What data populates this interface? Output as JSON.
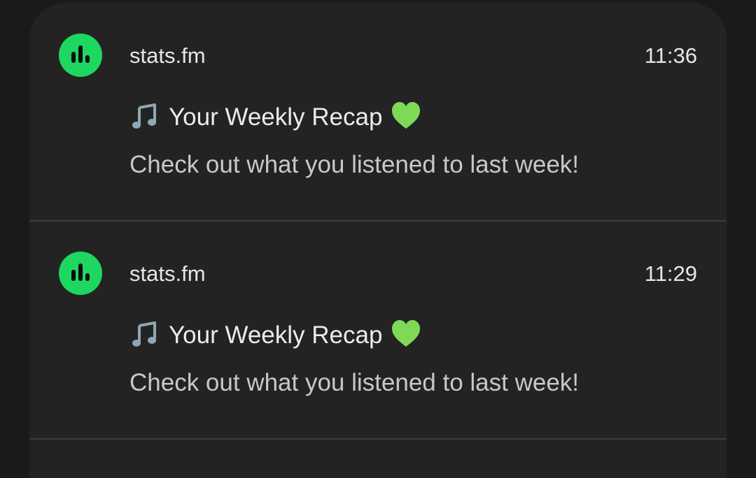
{
  "notifications": [
    {
      "app_name": "stats.fm",
      "time": "11:36",
      "title": "Your Weekly Recap",
      "body": "Check out what you listened to last week!",
      "icons": {
        "app": "stats-fm-logo-icon",
        "lead": "musical-note-icon",
        "trail": "green-heart-icon"
      }
    },
    {
      "app_name": "stats.fm",
      "time": "11:29",
      "title": "Your Weekly Recap",
      "body": "Check out what you listened to last week!",
      "icons": {
        "app": "stats-fm-logo-icon",
        "lead": "musical-note-icon",
        "trail": "green-heart-icon"
      }
    }
  ],
  "colors": {
    "background": "#1a1a1a",
    "panel": "#232323",
    "app_icon": "#1ed760",
    "heart": "#7ed957",
    "note": "#8fa7b5"
  }
}
